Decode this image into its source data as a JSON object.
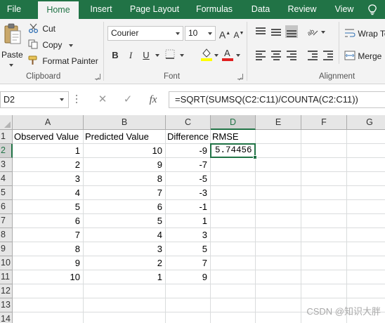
{
  "tabs": [
    "File",
    "Home",
    "Insert",
    "Page Layout",
    "Formulas",
    "Data",
    "Review",
    "View"
  ],
  "ribbon": {
    "clipboard": {
      "paste_label": "Paste",
      "cut_label": "Cut",
      "copy_label": "Copy",
      "format_painter_label": "Format Painter",
      "group_label": "Clipboard"
    },
    "font": {
      "font_name": "Courier",
      "font_size": "10",
      "group_label": "Font",
      "bold": "B",
      "italic": "I",
      "underline": "U"
    },
    "alignment": {
      "wrap_text_label": "Wrap Te",
      "merge_label": "Merge",
      "group_label": "Alignment"
    }
  },
  "formula_bar": {
    "name_box": "D2",
    "formula": "=SQRT(SUMSQ(C2:C11)/COUNTA(C2:C11))",
    "fx_label": "fx"
  },
  "grid": {
    "columns": [
      "A",
      "B",
      "C",
      "D",
      "E",
      "F",
      "G"
    ],
    "rows": [
      "1",
      "2",
      "3",
      "4",
      "5",
      "6",
      "7",
      "8",
      "9",
      "10",
      "11",
      "12",
      "13",
      "14"
    ],
    "headers": [
      "Observed Value",
      "Predicted Value",
      "Difference",
      "RMSE"
    ],
    "observed": [
      "1",
      "2",
      "3",
      "4",
      "5",
      "6",
      "7",
      "8",
      "9",
      "10"
    ],
    "predicted": [
      "10",
      "9",
      "8",
      "7",
      "6",
      "5",
      "4",
      "3",
      "2",
      "1"
    ],
    "difference": [
      "-9",
      "-7",
      "-5",
      "-3",
      "-1",
      "1",
      "3",
      "5",
      "7",
      "9"
    ],
    "rmse": "5.74456",
    "selected_cell": "D2"
  },
  "watermark": "CSDN @知识大胖",
  "colors": {
    "excel_green": "#217346",
    "ribbon_bg": "#f3f3f3",
    "header_bg": "#e6e6e6"
  }
}
